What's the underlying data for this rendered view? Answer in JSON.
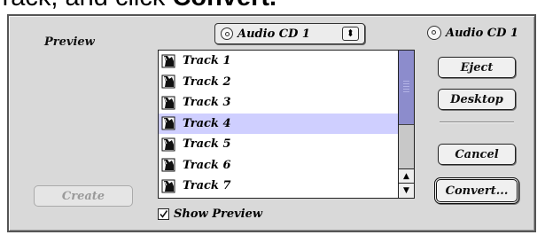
{
  "caption": {
    "before": "Track, and click ",
    "emphasis": "Convert."
  },
  "dialog": {
    "preview_label": "Preview",
    "source_popup": {
      "selected": "Audio CD 1",
      "arrows": "⬍",
      "icon": "cd-icon"
    },
    "volume": {
      "icon": "cd-icon",
      "label": "Audio CD 1"
    },
    "tracks": [
      {
        "label": "Track  1",
        "selected": false
      },
      {
        "label": "Track  2",
        "selected": false
      },
      {
        "label": "Track  3",
        "selected": false
      },
      {
        "label": "Track  4",
        "selected": true
      },
      {
        "label": "Track  5",
        "selected": false
      },
      {
        "label": "Track  6",
        "selected": false
      },
      {
        "label": "Track  7",
        "selected": false
      }
    ],
    "buttons": {
      "eject": "Eject",
      "desktop": "Desktop",
      "cancel": "Cancel",
      "convert": "Convert...",
      "create": "Create"
    },
    "show_preview": {
      "label": "Show Preview",
      "checked": true
    },
    "colors": {
      "selection": "#cfcfff",
      "scroll_thumb": "#8c8ccc"
    }
  }
}
